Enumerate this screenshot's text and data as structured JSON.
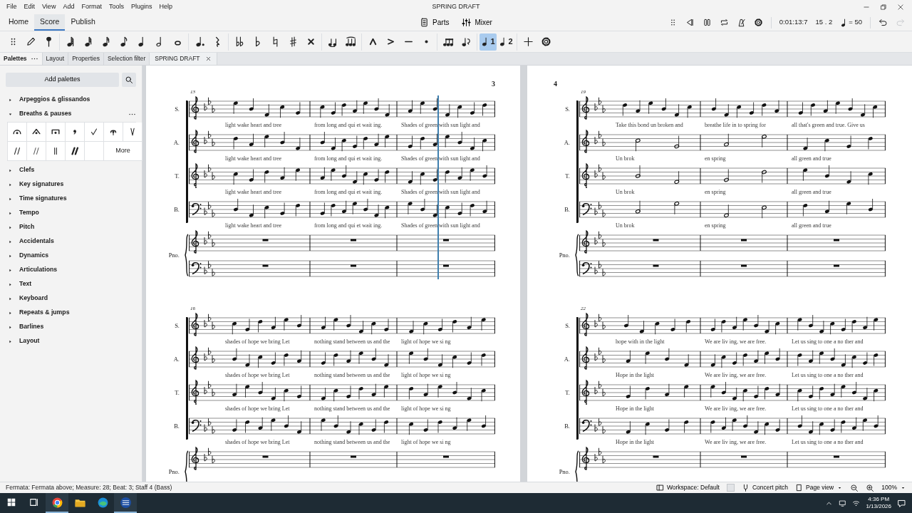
{
  "window": {
    "title": "SPRING DRAFT"
  },
  "menu": [
    "File",
    "Edit",
    "View",
    "Add",
    "Format",
    "Tools",
    "Plugins",
    "Help"
  ],
  "main_tabs": [
    {
      "label": "Home",
      "selected": false
    },
    {
      "label": "Score",
      "selected": true
    },
    {
      "label": "Publish",
      "selected": false
    }
  ],
  "top_buttons": [
    {
      "kind": "parts",
      "label": "Parts"
    },
    {
      "kind": "mixer",
      "label": "Mixer"
    }
  ],
  "playback": {
    "time": "0:01:13:7",
    "position": "15 . 2",
    "tempo": "= 50"
  },
  "history": {
    "undo_disabled": false,
    "redo_disabled": true
  },
  "voices": [
    {
      "label": "1",
      "selected": true
    },
    {
      "label": "2",
      "selected": false
    }
  ],
  "panel_tabs": [
    {
      "label": "Palettes",
      "selected": true
    },
    {
      "label": "Layout",
      "selected": false
    },
    {
      "label": "Properties",
      "selected": false
    },
    {
      "label": "Selection filter",
      "selected": false
    }
  ],
  "document_tab": {
    "label": "SPRING DRAFT"
  },
  "palettes": {
    "add_button": "Add palettes",
    "more_button": "More",
    "items": [
      {
        "label": "Arpeggios & glissandos",
        "expanded": false
      },
      {
        "label": "Breaths & pauses",
        "expanded": true
      },
      {
        "label": "Clefs",
        "expanded": false
      },
      {
        "label": "Key signatures",
        "expanded": false
      },
      {
        "label": "Time signatures",
        "expanded": false
      },
      {
        "label": "Tempo",
        "expanded": false
      },
      {
        "label": "Pitch",
        "expanded": false
      },
      {
        "label": "Accidentals",
        "expanded": false
      },
      {
        "label": "Dynamics",
        "expanded": false
      },
      {
        "label": "Articulations",
        "expanded": false
      },
      {
        "label": "Text",
        "expanded": false
      },
      {
        "label": "Keyboard",
        "expanded": false
      },
      {
        "label": "Repeats & jumps",
        "expanded": false
      },
      {
        "label": "Barlines",
        "expanded": false
      },
      {
        "label": "Layout",
        "expanded": false
      }
    ]
  },
  "score": {
    "pages": [
      {
        "number": "3",
        "systems": [
          {
            "measure_number": "13",
            "playback_cursor": true,
            "piano_label": "Pno.",
            "staves": [
              {
                "label": "S.",
                "kind": "treble",
                "lyrics": [
                  "light wake heart and tree",
                  "from long and qui et wait ing.",
                  "Shades of green with sun light and"
                ]
              },
              {
                "label": "A.",
                "kind": "treble",
                "lyrics": [
                  "light wake heart and tree",
                  "from long and qui et wait ing.",
                  "Shades of green with sun light and"
                ]
              },
              {
                "label": "T.",
                "kind": "treble8",
                "lyrics": [
                  "light wake heart and tree",
                  "from long and qui et wait ing.",
                  "Shades of green with sun light and"
                ]
              },
              {
                "label": "B.",
                "kind": "bass",
                "lyrics": [
                  "light wake heart and tree",
                  "from long and qui et wait ing.",
                  "Shades of green with sun light and"
                ]
              }
            ]
          },
          {
            "measure_number": "16",
            "piano_label": "Pno.",
            "staves": [
              {
                "label": "S.",
                "kind": "treble",
                "lyrics": [
                  "shades of hope we bring Let",
                  "nothing stand between us and the",
                  "light of hope we si ng"
                ]
              },
              {
                "label": "A.",
                "kind": "treble",
                "lyrics": [
                  "shades of hope we bring Let",
                  "nothing stand between us and the",
                  "light of hope we si ng"
                ]
              },
              {
                "label": "T.",
                "kind": "treble8",
                "lyrics": [
                  "shades of hope we bring Let",
                  "nothing stand between us and the",
                  "light of hope we si ng"
                ]
              },
              {
                "label": "B.",
                "kind": "bass",
                "lyrics": [
                  "shades of hope we bring Let",
                  "nothing stand between us and the",
                  "light of hope we si ng"
                ]
              }
            ]
          }
        ]
      },
      {
        "number": "4",
        "systems": [
          {
            "measure_number": "19",
            "piano_label": "Pno.",
            "staves": [
              {
                "label": "S.",
                "kind": "treble",
                "lyrics": [
                  "Take this bond un broken and",
                  "breathe life in to spring for",
                  "all that's green and true. Give us"
                ]
              },
              {
                "label": "A.",
                "kind": "treble",
                "lyrics": [
                  "Un brok",
                  "en spring",
                  "all green and true"
                ]
              },
              {
                "label": "T.",
                "kind": "treble8",
                "lyrics": [
                  "Un brok",
                  "en spring",
                  "all green and true"
                ]
              },
              {
                "label": "B.",
                "kind": "bass",
                "lyrics": [
                  "Un brok",
                  "en spring",
                  "all green and true"
                ]
              }
            ]
          },
          {
            "measure_number": "22",
            "piano_label": "Pno.",
            "staves": [
              {
                "label": "S.",
                "kind": "treble",
                "lyrics": [
                  "hope with in the light",
                  "We are liv ing, we are free.",
                  "Let us sing to one a no ther and"
                ]
              },
              {
                "label": "A.",
                "kind": "treble",
                "lyrics": [
                  "Hope in the light",
                  "We are liv ing, we are free.",
                  "Let us sing to one a no ther and"
                ]
              },
              {
                "label": "T.",
                "kind": "treble8",
                "lyrics": [
                  "Hope in the light",
                  "We are liv ing, we are free.",
                  "Let us sing to one a no ther and"
                ]
              },
              {
                "label": "B.",
                "kind": "bass",
                "lyrics": [
                  "Hope in the light",
                  "We are liv ing, we are free.",
                  "Let us sing to one a no ther and"
                ]
              }
            ]
          }
        ]
      }
    ]
  },
  "status_bar": {
    "message": "Fermata: Fermata above; Measure: 28; Beat: 3; Staff 4 (Bass)",
    "workspace": "Workspace: Default",
    "concert_pitch": {
      "label": "Concert pitch",
      "checked": false
    },
    "view": "Page view",
    "zoom": "100%"
  },
  "taskbar": {
    "apps": [
      {
        "kind": "browser",
        "running": true
      },
      {
        "kind": "folder",
        "running": false
      },
      {
        "kind": "browser2",
        "running": false
      },
      {
        "kind": "score",
        "running": true
      }
    ],
    "time": "4:36 PM",
    "date": "1/13/2026"
  }
}
